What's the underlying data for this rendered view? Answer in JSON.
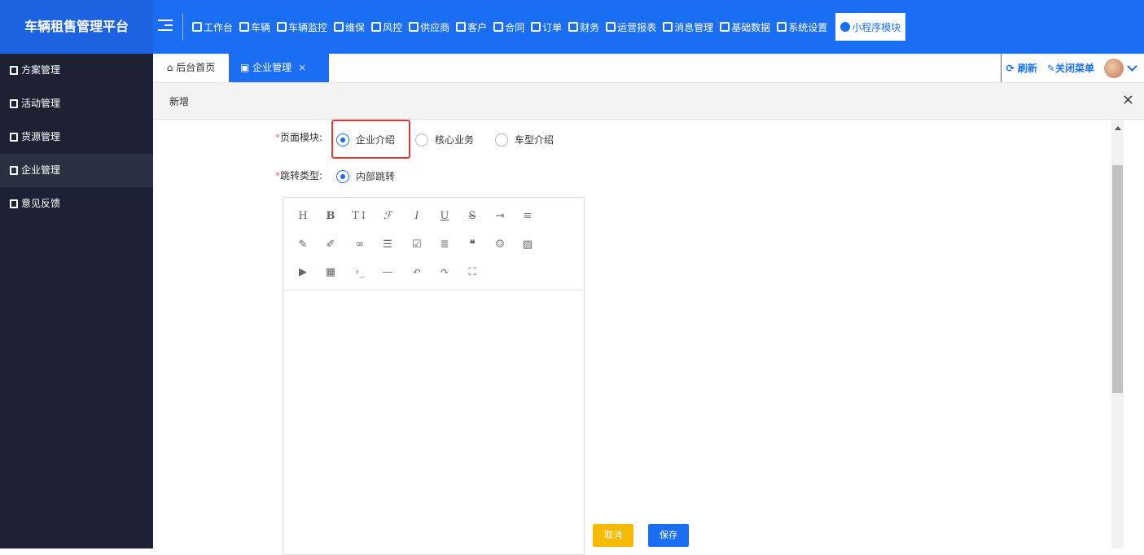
{
  "app": {
    "title": "车辆租售管理平台"
  },
  "nav": [
    {
      "label": "工作台"
    },
    {
      "label": "车辆"
    },
    {
      "label": "车辆监控"
    },
    {
      "label": "维保"
    },
    {
      "label": "风控"
    },
    {
      "label": "供应商"
    },
    {
      "label": "客户"
    },
    {
      "label": "合同"
    },
    {
      "label": "订单"
    },
    {
      "label": "财务"
    },
    {
      "label": "运营报表"
    },
    {
      "label": "消息管理"
    },
    {
      "label": "基础数据"
    },
    {
      "label": "系统设置"
    },
    {
      "label": "小程序模块"
    }
  ],
  "sidebar": {
    "items": [
      {
        "label": "方案管理"
      },
      {
        "label": "活动管理"
      },
      {
        "label": "货源管理"
      },
      {
        "label": "企业管理"
      },
      {
        "label": "意见反馈"
      }
    ],
    "active_index": 3
  },
  "tabs": {
    "home": "后台首页",
    "current": "企业管理",
    "close": "×",
    "refresh": "刷新",
    "close_menu": "关闭菜单"
  },
  "subheader": {
    "title": "新增",
    "close": "×"
  },
  "form": {
    "module_label": "页面模块:",
    "module_options": [
      "企业介绍",
      "核心业务",
      "车型介绍"
    ],
    "module_selected": "企业介绍",
    "jump_label": "跳转类型:",
    "jump_options": [
      "内部跳转"
    ],
    "jump_selected": "内部跳转",
    "required_mark": "*"
  },
  "editor_toolbar": [
    [
      "H",
      "B",
      "TI",
      "F",
      "I",
      "U",
      "S",
      "indent",
      "align"
    ],
    [
      "pen",
      "brush",
      "link",
      "list",
      "check",
      "left",
      "quote",
      "emoji",
      "image"
    ],
    [
      "video",
      "table",
      "code",
      "hr",
      "undo",
      "redo",
      "fullscreen"
    ]
  ],
  "buttons": {
    "cancel": "取消",
    "save": "保存"
  },
  "colors": {
    "primary": "#1a6ef3",
    "sidebar": "#1c2233",
    "cancel": "#f7ba00",
    "highlight": "#e53935"
  }
}
